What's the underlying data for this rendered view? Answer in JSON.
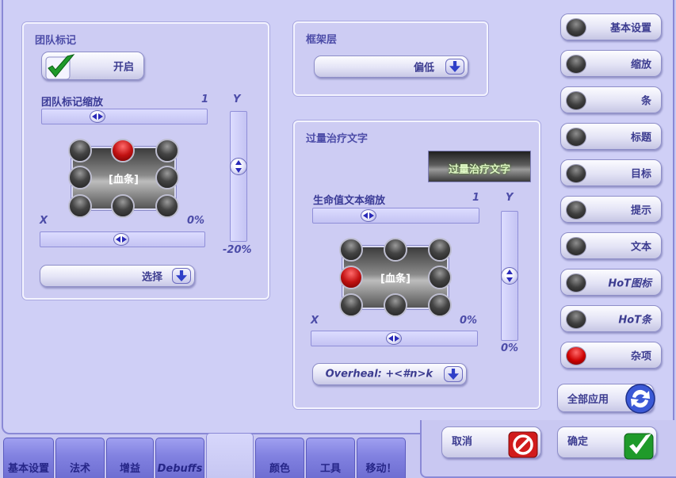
{
  "raid_marker": {
    "title": "团队标记",
    "toggle_label": "开启",
    "scale_label": "团队标记缩放",
    "scale_value": "1",
    "y_label": "Y",
    "y_value": "-20%",
    "x_label": "X",
    "x_value": "0%",
    "preview_text": "[血条]",
    "select_label": "选择"
  },
  "frame_strata": {
    "title": "框架层",
    "dropdown_value": "偏低"
  },
  "overheal_text": {
    "title": "过量治疗文字",
    "preview_button": "过量治疗文字",
    "scale_label": "生命值文本缩放",
    "scale_value": "1",
    "y_label": "Y",
    "y_value": "0%",
    "x_label": "X",
    "x_value": "0%",
    "preview_text": "[血条]",
    "format_value": "Overheal: +<#n>k"
  },
  "side_menu": [
    {
      "label": "基本设置",
      "active": false
    },
    {
      "label": "缩放",
      "active": false
    },
    {
      "label": "条",
      "active": false
    },
    {
      "label": "标题",
      "active": false
    },
    {
      "label": "目标",
      "active": false
    },
    {
      "label": "提示",
      "active": false
    },
    {
      "label": "文本",
      "active": false
    },
    {
      "label": "HoT图标",
      "active": false
    },
    {
      "label": "HoT条",
      "active": false
    },
    {
      "label": "杂项",
      "active": true
    }
  ],
  "actions": {
    "apply_all": "全部应用",
    "cancel": "取消",
    "ok": "确定"
  },
  "tabs": [
    {
      "label": "基本设置"
    },
    {
      "label": "法术"
    },
    {
      "label": "增益"
    },
    {
      "label": "Debuffs"
    },
    {
      "label": ""
    },
    {
      "label": "颜色"
    },
    {
      "label": "工具"
    },
    {
      "label": "移动！"
    }
  ],
  "colors": {
    "accent": "#2f3fc8",
    "panel": "#cdccf3",
    "active_led": "#c21212"
  }
}
